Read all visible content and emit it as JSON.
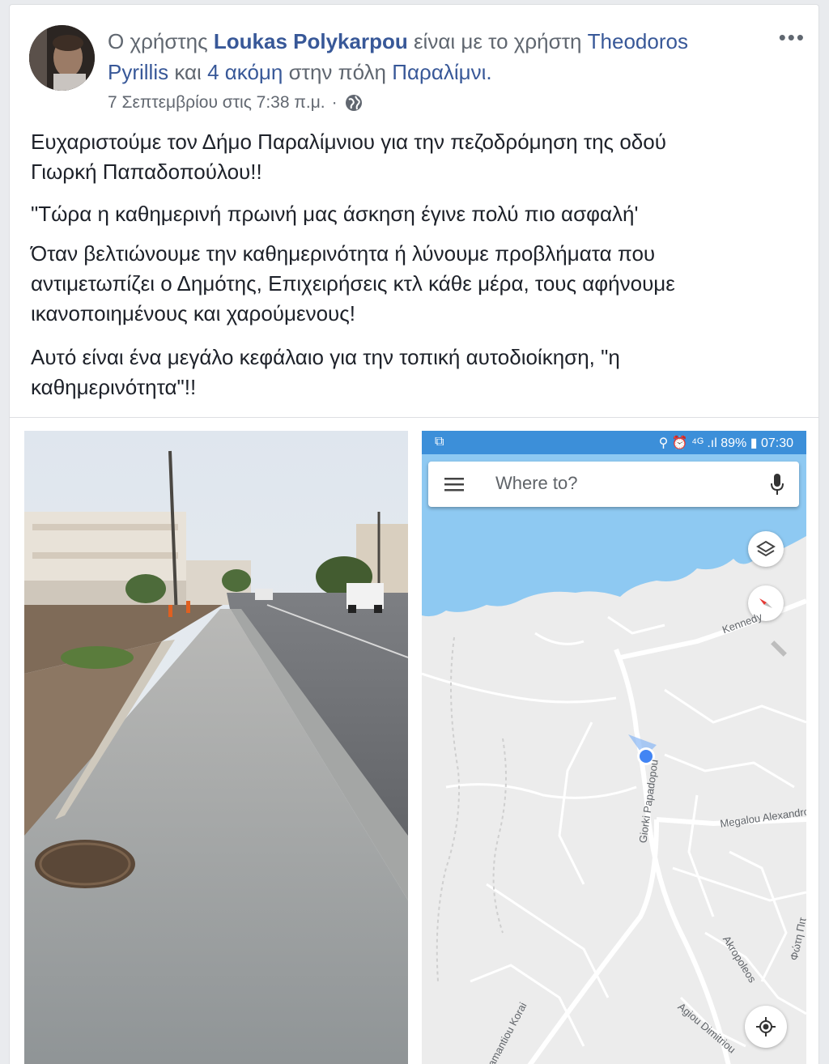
{
  "post": {
    "prefix": "Ο χρήστης",
    "author": "Loukas Polykarpou",
    "with_text": "είναι με το χρήστη",
    "tagged_user_1": "Theodoros",
    "tagged_user_2": "Pyrillis",
    "and_text": "και",
    "others": "4 ακόμη",
    "in_city": "στην πόλη",
    "location": "Παραλίμνι.",
    "timestamp": "7 Σεπτεμβρίου στις 7:38 π.μ.",
    "separator": "·",
    "more_label": "•••",
    "paragraphs": [
      [
        "Ευχαριστούμε τον Δήμο Παραλίμνιου για την πεζοδρόμηση της οδού",
        "Γιωρκή Παπαδοπούλου!!"
      ],
      [
        "\"Τώρα η καθημερινή πρωινή μας άσκηση έγινε πολύ πιο ασφαλή'"
      ],
      [
        "Όταν βελτιώνουμε την καθημερινότητα ή λύνουμε προβλήματα που",
        "αντιμετωπίζει ο Δημότης, Επιχειρήσεις κτλ κάθε μέρα, τους αφήνουμε",
        "ικανοποιημένους και χαρούμενους!"
      ],
      [
        "Αυτό είναι ένα μεγάλο κεφάλαιο για την τοπική αυτοδιοίκηση, \"η",
        "καθημερινότητα\"!!"
      ]
    ]
  },
  "map": {
    "status_right": "⚲ ⏰ ⁴ᴳ .ıl 89% ▮ 07:30",
    "search_placeholder": "Where to?",
    "labels": {
      "kennedy": "Kennedy",
      "giorki": "Giorki Papadopou",
      "megalou": "Megalou Alexandro",
      "akropoleos": "Akropoleos",
      "agiou": "Agiou Dimitriou",
      "adamantiou": "Adamantiou Korai",
      "fotis": "Φώτη Πιτ"
    },
    "colors": {
      "water": "#8ec9f2",
      "land": "#ececec",
      "road": "#ffffff",
      "accent": "#4285f4"
    }
  }
}
